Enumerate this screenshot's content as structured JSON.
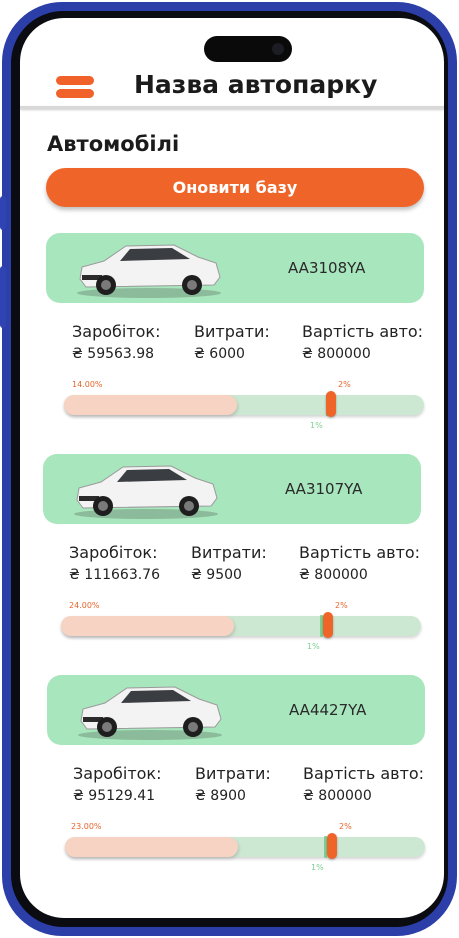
{
  "header": {
    "title": "Назва автопарку"
  },
  "section": {
    "title": "Автомобілі",
    "update_label": "Оновити базу"
  },
  "labels": {
    "income": "Заробіток:",
    "expenses": "Витрати:",
    "value": "Вартість авто:"
  },
  "colors": {
    "accent": "#ef6428",
    "card": "#a8e6bd",
    "track": "#cde8d2",
    "fill": "#f7d3c3"
  },
  "cars": [
    {
      "plate": "AA3108YA",
      "income": "₴ 59563.98",
      "expenses": "₴ 6000",
      "value": "₴ 800000",
      "progress_label": "14.00%",
      "progress_fraction": 0.48,
      "target_label": "2%",
      "min_label": "1%"
    },
    {
      "plate": "AA3107YA",
      "income": "₴ 111663.76",
      "expenses": "₴ 9500",
      "value": "₴ 800000",
      "progress_label": "24.00%",
      "progress_fraction": 0.48,
      "target_label": "2%",
      "min_label": "1%"
    },
    {
      "plate": "AA4427YA",
      "income": "₴ 95129.41",
      "expenses": "₴ 8900",
      "value": "₴ 800000",
      "progress_label": "23.00%",
      "progress_fraction": 0.48,
      "target_label": "2%",
      "min_label": "1%"
    }
  ]
}
